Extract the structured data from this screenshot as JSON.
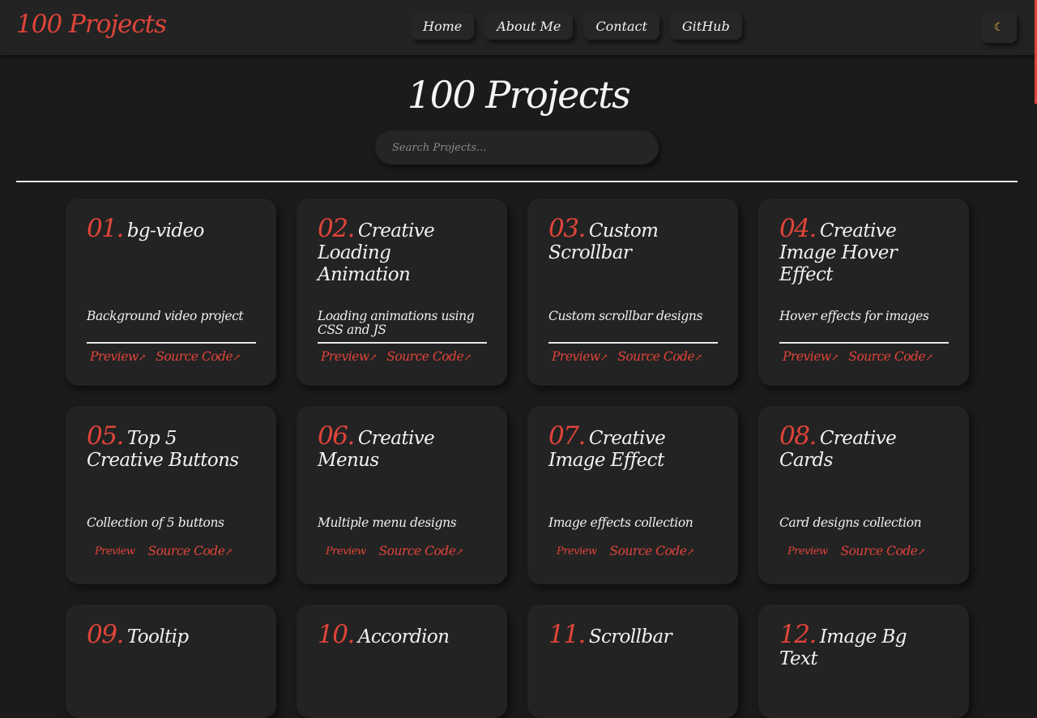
{
  "nav": {
    "brand": "100 Projects",
    "links": [
      "Home",
      "About Me",
      "Contact",
      "GitHub"
    ],
    "theme_icon": "☾"
  },
  "hero": {
    "title": "100 Projects",
    "search_placeholder": "Search Projects..."
  },
  "colors": {
    "accent": "#e0443a",
    "background": "#1b1b1b",
    "card": "#232323"
  },
  "projects": [
    {
      "num": "01.",
      "title": "bg-video",
      "desc": "Background video project",
      "preview": "Preview",
      "source": "Source Code"
    },
    {
      "num": "02.",
      "title": "Creative Loading Animation",
      "desc": "Loading animations using CSS and JS",
      "preview": "Preview",
      "source": "Source Code"
    },
    {
      "num": "03.",
      "title": "Custom Scrollbar",
      "desc": "Custom scrollbar designs",
      "preview": "Preview",
      "source": "Source Code"
    },
    {
      "num": "04.",
      "title": "Creative Image Hover Effect",
      "desc": "Hover effects for images",
      "preview": "Preview",
      "source": "Source Code"
    },
    {
      "num": "05.",
      "title": "Top 5 Creative Buttons",
      "desc": "Collection of 5 buttons",
      "preview": "Preview",
      "source": "Source Code"
    },
    {
      "num": "06.",
      "title": "Creative Menus",
      "desc": "Multiple menu designs",
      "preview": "Preview",
      "source": "Source Code"
    },
    {
      "num": "07.",
      "title": "Creative Image Effect",
      "desc": "Image effects collection",
      "preview": "Preview",
      "source": "Source Code"
    },
    {
      "num": "08.",
      "title": "Creative Cards",
      "desc": "Card designs collection",
      "preview": "Preview",
      "source": "Source Code"
    },
    {
      "num": "09.",
      "title": "Tooltip"
    },
    {
      "num": "10.",
      "title": "Accordion"
    },
    {
      "num": "11.",
      "title": "Scrollbar"
    },
    {
      "num": "12.",
      "title": "Image Bg Text"
    }
  ]
}
